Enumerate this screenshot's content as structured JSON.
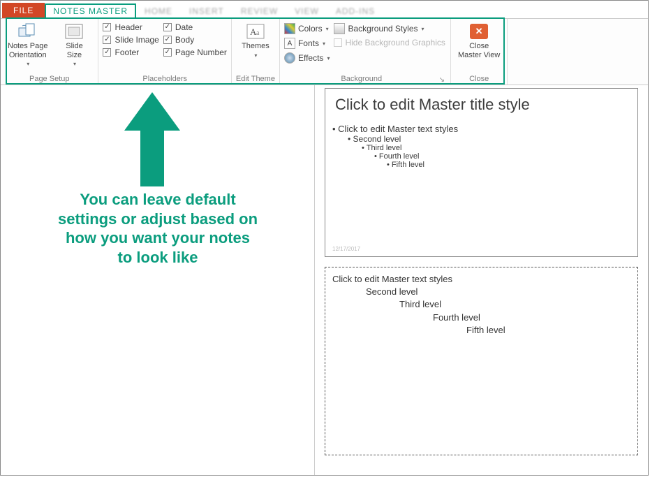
{
  "tabs": {
    "file": "FILE",
    "notes_master": "NOTES MASTER",
    "home": "HOME",
    "insert": "INSERT",
    "review": "REVIEW",
    "view": "VIEW",
    "addins": "ADD-INS"
  },
  "ribbon": {
    "page_setup": {
      "label": "Page Setup",
      "notes_page_orientation": "Notes Page\nOrientation",
      "slide_size": "Slide\nSize"
    },
    "placeholders": {
      "label": "Placeholders",
      "header": "Header",
      "slide_image": "Slide Image",
      "footer": "Footer",
      "date": "Date",
      "body": "Body",
      "page_number": "Page Number"
    },
    "edit_theme": {
      "label": "Edit Theme",
      "themes": "Themes"
    },
    "background": {
      "label": "Background",
      "colors": "Colors",
      "fonts": "Fonts",
      "effects": "Effects",
      "bg_styles": "Background Styles",
      "hide_bg": "Hide Background Graphics"
    },
    "close": {
      "label": "Close",
      "close_master": "Close\nMaster View"
    }
  },
  "annotation": "You can leave default settings or adjust based on how you want your notes to look like",
  "slide": {
    "title": "Click to edit Master title style",
    "l1": "Click to edit Master text styles",
    "l2": "Second level",
    "l3": "Third level",
    "l4": "Fourth level",
    "l5": "Fifth level",
    "date": "12/17/2017"
  },
  "notes": {
    "l1": "Click to edit Master text styles",
    "l2": "Second level",
    "l3": "Third level",
    "l4": "Fourth level",
    "l5": "Fifth level"
  }
}
